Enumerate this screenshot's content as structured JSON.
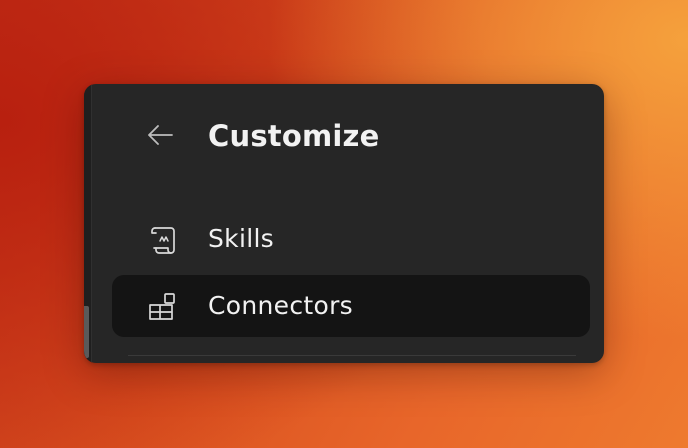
{
  "panel": {
    "title": "Customize",
    "back_icon": "arrow-left-icon"
  },
  "menu": {
    "items": [
      {
        "label": "Skills",
        "icon": "scroll-icon",
        "selected": false
      },
      {
        "label": "Connectors",
        "icon": "blocks-icon",
        "selected": true
      }
    ]
  },
  "colors": {
    "panel_bg": "#262626",
    "selected_bg": "#141414",
    "text": "#f2f2f2",
    "icon": "#d8d8d8"
  }
}
